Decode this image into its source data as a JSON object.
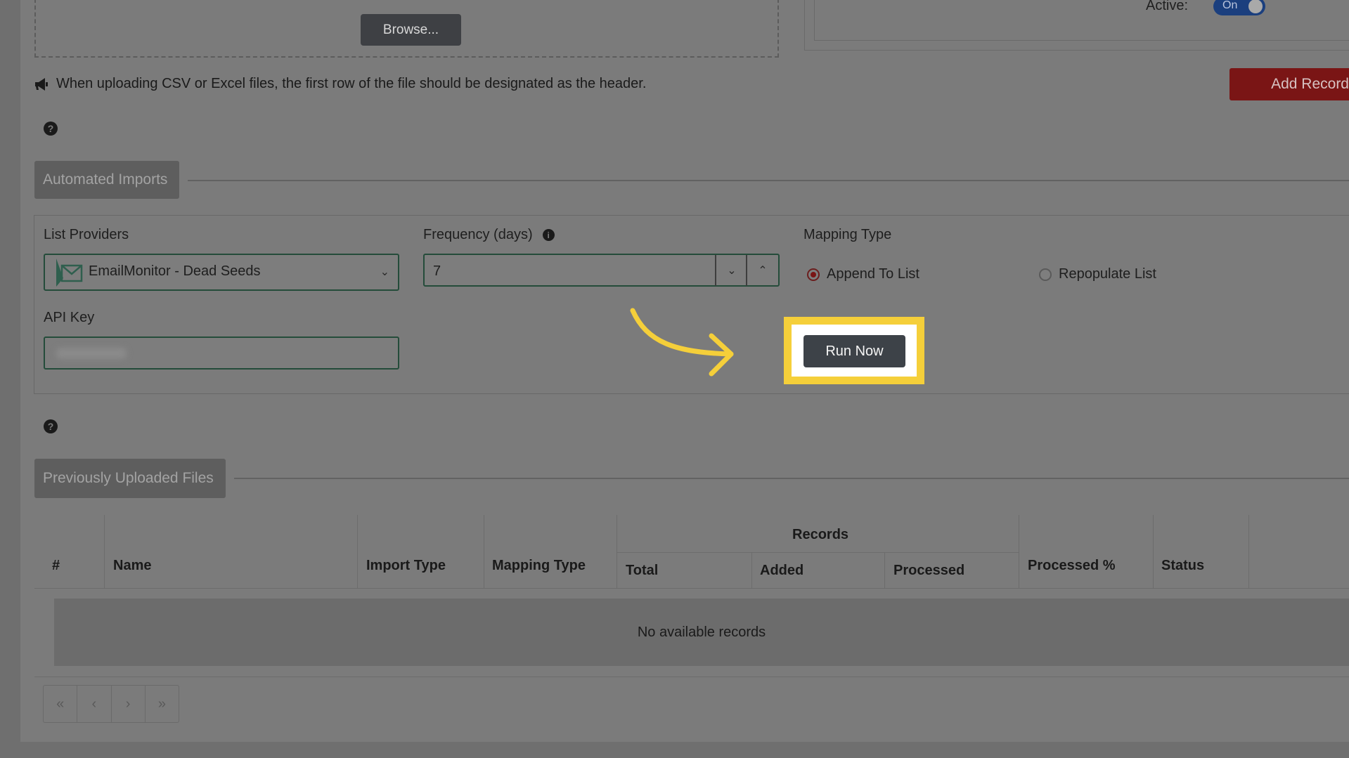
{
  "upload": {
    "browse_label": "Browse..."
  },
  "status": {
    "active_label": "Active:",
    "toggle_label": "On"
  },
  "actions": {
    "add_record_label": "Add Record",
    "run_now_label": "Run Now"
  },
  "notice": {
    "text": "When uploading CSV or Excel files, the first row of the file should be designated as the header."
  },
  "automated_imports": {
    "title": "Automated Imports",
    "list_providers_label": "List Providers",
    "provider_value": "EmailMonitor - Dead Seeds",
    "frequency_label": "Frequency (days)",
    "frequency_value": "7",
    "api_key_label": "API Key",
    "mapping_type_label": "Mapping Type",
    "mapping_options": [
      {
        "label": "Append To List",
        "selected": true
      },
      {
        "label": "Repopulate List",
        "selected": false
      }
    ]
  },
  "uploaded_files": {
    "title": "Previously Uploaded Files",
    "columns": [
      "#",
      "Name",
      "Import Type",
      "Mapping Type",
      "Processed %",
      "Status"
    ],
    "records_group": "Records",
    "records_columns": [
      "Total",
      "Added",
      "Processed"
    ],
    "empty_text": "No available records"
  },
  "pagination": {
    "first": "«",
    "prev": "‹",
    "next": "›",
    "last": "»"
  },
  "colors": {
    "highlight": "#f5cf3a",
    "add_record": "#7a1515",
    "toggle": "#1b3f7e",
    "arrow": "#f5cf3a"
  },
  "icons": [
    "megaphone-icon",
    "help-icon",
    "info-icon",
    "envelope-icon",
    "chevron-down-icon",
    "chevron-up-icon",
    "arrow-icon"
  ]
}
